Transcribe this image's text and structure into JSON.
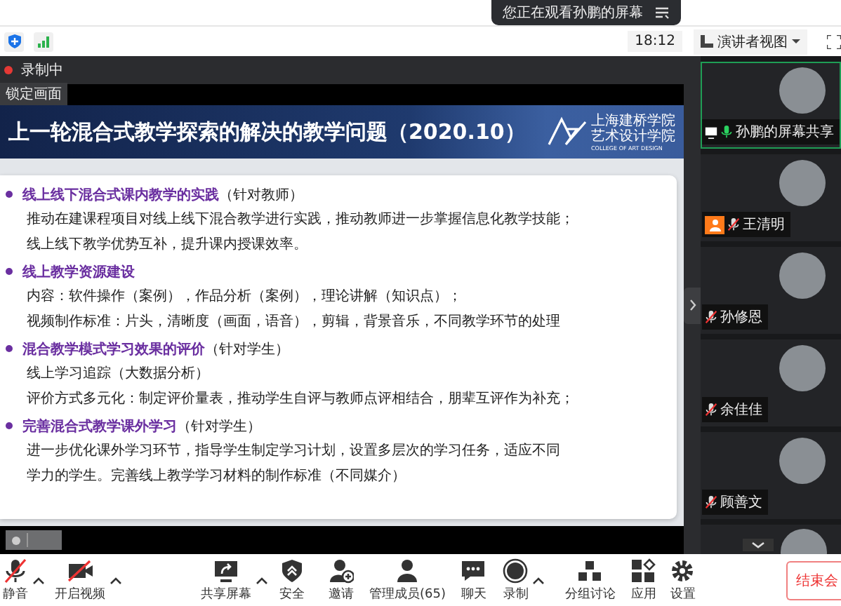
{
  "banner": {
    "text": "您正在观看孙鹏的屏幕"
  },
  "top_bar": {
    "time": "18:12",
    "view_mode": "演讲者视图"
  },
  "recording": {
    "label": "录制中",
    "on": true
  },
  "lock_tag": "锁定画面",
  "slide": {
    "title": "上一轮混合式教学探索的解决的教学问题（2020.10）",
    "logo_lines": [
      "上海建桥学院",
      "艺术设计学院"
    ],
    "logo_en": "COLLEGE OF ART DESIGN",
    "sections": [
      {
        "heading": "线上线下混合式课内教学的实践",
        "note": "（针对教师）",
        "lines": [
          "推动在建课程项目对线上线下混合教学进行实践，推动教师进一步掌握信息化教学技能；",
          "线上线下教学优势互补，提升课内授课效率。"
        ]
      },
      {
        "heading": "线上教学资源建设",
        "lines": [
          "内容：软件操作（案例），作品分析（案例），理论讲解（知识点）；",
          "视频制作标准：片头，清晰度（画面，语音），剪辑，背景音乐，不同教学环节的处理"
        ]
      },
      {
        "heading": "混合教学模式学习效果的评价",
        "note": "（针对学生）",
        "lines": [
          "线上学习追踪（大数据分析）",
          "评价方式多元化：制定评价量表，推动学生自评与教师点评相结合，朋辈互评作为补充；"
        ]
      },
      {
        "heading": "完善混合式教学课外学习",
        "note": "（针对学生）",
        "lines": [
          "进一步优化课外学习环节，指导学生制定学习计划，设置多层次的学习任务，适应不同",
          "学力的学生。完善线上教学学习材料的制作标准（不同媒介）"
        ]
      }
    ]
  },
  "participants": [
    {
      "name": "孙鹏的屏幕共享",
      "muted": false,
      "sharing": true,
      "host": false,
      "active": true
    },
    {
      "name": "王清明",
      "muted": true,
      "sharing": false,
      "host": true,
      "active": false
    },
    {
      "name": "孙修恩",
      "muted": true,
      "sharing": false,
      "host": false,
      "active": false
    },
    {
      "name": "余佳佳",
      "muted": true,
      "sharing": false,
      "host": false,
      "active": false
    },
    {
      "name": "顾善文",
      "muted": true,
      "sharing": false,
      "host": false,
      "active": false
    }
  ],
  "toolbar": [
    {
      "label": "静音",
      "caret": true
    },
    {
      "label": "开启视频",
      "caret": true
    },
    {
      "label": "共享屏幕",
      "caret": true
    },
    {
      "label": "安全",
      "caret": false
    },
    {
      "label": "邀请",
      "caret": false
    },
    {
      "label": "管理成员(65)",
      "caret": false
    },
    {
      "label": "聊天",
      "caret": false
    },
    {
      "label": "录制",
      "caret": true
    },
    {
      "label": "分组讨论",
      "caret": false
    },
    {
      "label": "应用",
      "caret": false
    },
    {
      "label": "设置",
      "caret": false
    }
  ],
  "end_button": "结束会"
}
